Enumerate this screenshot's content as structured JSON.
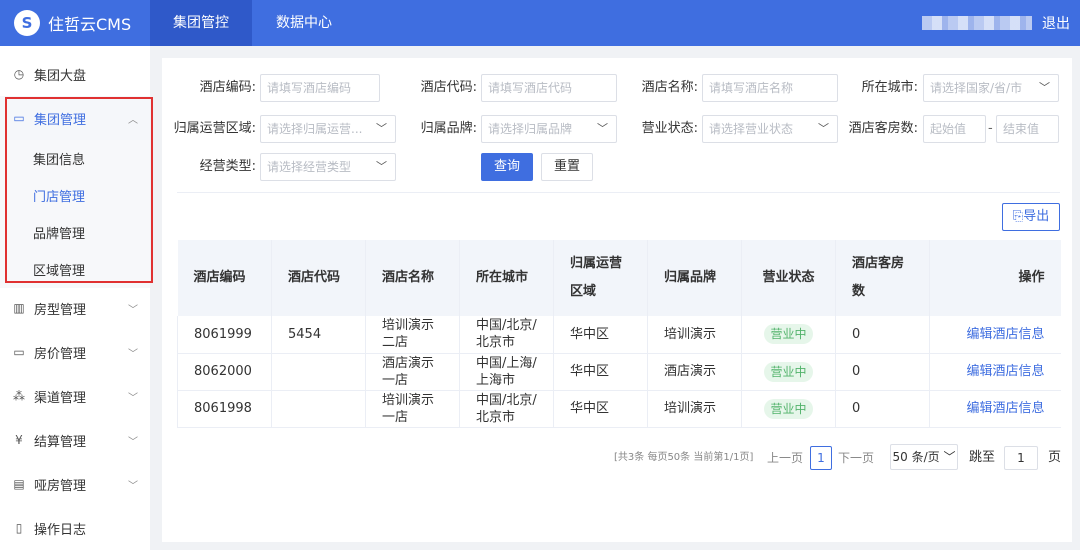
{
  "app": {
    "logo_glyph": "S",
    "title": "住哲云CMS"
  },
  "nav": {
    "tabs": [
      {
        "label": "集团管控"
      },
      {
        "label": "数据中心"
      }
    ],
    "logout": "退出"
  },
  "sidebar": {
    "items": [
      {
        "label": "集团大盘",
        "icon": "dashboard-icon"
      },
      {
        "label": "集团管理",
        "icon": "monitor-icon"
      },
      {
        "label": "房型管理",
        "icon": "building-icon"
      },
      {
        "label": "房价管理",
        "icon": "card-icon"
      },
      {
        "label": "渠道管理",
        "icon": "network-icon"
      },
      {
        "label": "结算管理",
        "icon": "yen-icon"
      },
      {
        "label": "哑房管理",
        "icon": "document-icon"
      },
      {
        "label": "操作日志",
        "icon": "log-icon"
      }
    ],
    "subitems": [
      {
        "label": "集团信息"
      },
      {
        "label": "门店管理"
      },
      {
        "label": "品牌管理"
      },
      {
        "label": "区域管理"
      }
    ]
  },
  "filters": {
    "hotel_code_label": "酒店编码:",
    "hotel_code_placeholder": "请填写酒店编码",
    "hotel_id_label": "酒店代码:",
    "hotel_id_placeholder": "请填写酒店代码",
    "hotel_name_label": "酒店名称:",
    "hotel_name_placeholder": "请填写酒店名称",
    "city_label": "所在城市:",
    "city_placeholder": "请选择国家/省/市",
    "region_label": "归属运营区域:",
    "region_placeholder": "请选择归属运营...",
    "brand_label": "归属品牌:",
    "brand_placeholder": "请选择归属品牌",
    "status_label": "营业状态:",
    "status_placeholder": "请选择营业状态",
    "rooms_label": "酒店客房数:",
    "rooms_min_placeholder": "起始值",
    "rooms_max_placeholder": "结束值",
    "type_label": "经营类型:",
    "type_placeholder": "请选择经营类型",
    "query": "查询",
    "reset": "重置",
    "export": "导出"
  },
  "table": {
    "headers": [
      "酒店编码",
      "酒店代码",
      "酒店名称",
      "所在城市",
      "归属运营区域",
      "归属品牌",
      "营业状态",
      "酒店客房数",
      "操作"
    ],
    "rows": [
      {
        "code": "8061999",
        "id": "5454",
        "name": "培训演示二店",
        "city": "中国/北京/北京市",
        "region": "华中区",
        "brand": "培训演示",
        "status": "营业中",
        "rooms": "0",
        "action": "编辑酒店信息"
      },
      {
        "code": "8062000",
        "id": "",
        "name": "酒店演示一店",
        "city": "中国/上海/上海市",
        "region": "华中区",
        "brand": "酒店演示",
        "status": "营业中",
        "rooms": "0",
        "action": "编辑酒店信息"
      },
      {
        "code": "8061998",
        "id": "",
        "name": "培训演示一店",
        "city": "中国/北京/北京市",
        "region": "华中区",
        "brand": "培训演示",
        "status": "营业中",
        "rooms": "0",
        "action": "编辑酒店信息"
      }
    ]
  },
  "pagination": {
    "summary": "[共3条 每页50条 当前第1/1页]",
    "prev": "上一页",
    "current": "1",
    "next": "下一页",
    "page_size": "50 条/页",
    "jump_label": "跳至",
    "jump_value": "1",
    "page_unit": "页"
  }
}
